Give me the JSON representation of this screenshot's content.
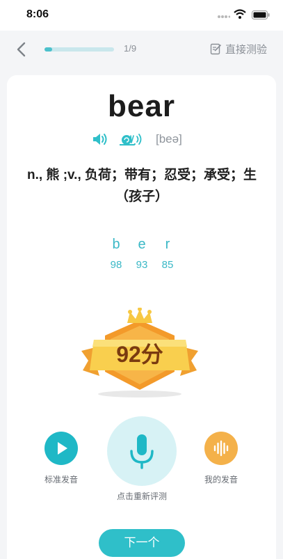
{
  "status_bar": {
    "time": "8:06"
  },
  "header": {
    "progress_text": "1/9",
    "progress_fraction": 0.11,
    "direct_test_label": "直接测验"
  },
  "word_card": {
    "word": "bear",
    "phonetic": "[beə]",
    "definition": "n., 熊 ;v., 负荷；带有；忍受；承受；生（孩子）",
    "phonemes": [
      {
        "letter": "b",
        "score": "98"
      },
      {
        "letter": "e",
        "score": "93"
      },
      {
        "letter": "r",
        "score": "85"
      }
    ],
    "total_score": "92分"
  },
  "controls": {
    "standard_label": "标准发音",
    "record_label": "点击重新评测",
    "mine_label": "我的发音"
  },
  "footer": {
    "next_label": "下一个"
  },
  "colors": {
    "accent": "#2fbfc9",
    "accent_light": "#d7f2f5",
    "orange": "#f4b14a",
    "badge_gold": "#f7c843"
  },
  "icons": {
    "back": "chevron-left-icon",
    "edit": "edit-icon",
    "speaker": "speaker-icon",
    "slow": "snail-icon",
    "play": "play-icon",
    "mic": "microphone-icon",
    "waveform": "waveform-icon"
  }
}
